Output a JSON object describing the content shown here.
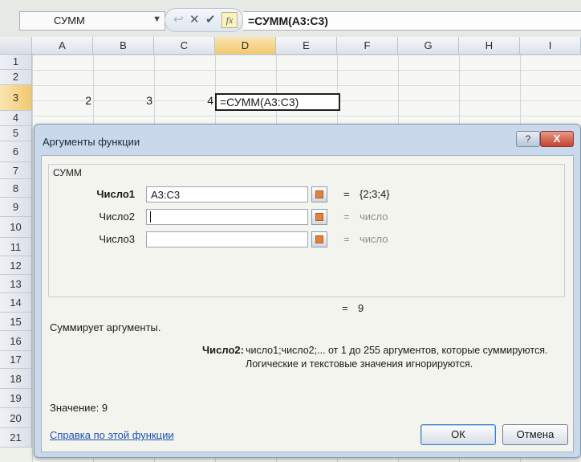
{
  "formula_bar": {
    "name_box": "СУММ",
    "formula": "=СУММ(A3:C3)",
    "fx_label": "fx"
  },
  "columns": [
    "A",
    "B",
    "C",
    "D",
    "E",
    "F",
    "G",
    "H",
    "I"
  ],
  "rows": [
    "1",
    "2",
    "3",
    "4",
    "5",
    "6",
    "7",
    "8",
    "9",
    "10",
    "11",
    "12",
    "13",
    "14",
    "15",
    "16",
    "17",
    "18",
    "19",
    "20",
    "21"
  ],
  "cells": {
    "A3": "2",
    "B3": "3",
    "C3": "4",
    "D3": "=СУММ(A3:C3)"
  },
  "dialog": {
    "title": "Аргументы функции",
    "function_name": "СУММ",
    "args": [
      {
        "label": "Число1",
        "value": "A3:C3",
        "result": "{2;3;4}"
      },
      {
        "label": "Число2",
        "value": "",
        "result": "число"
      },
      {
        "label": "Число3",
        "value": "",
        "result": "число"
      }
    ],
    "equals": "=",
    "total": "9",
    "description": "Суммирует аргументы.",
    "arg_desc_label": "Число2:",
    "arg_desc_text": "число1;число2;... от 1 до 255 аргументов, которые суммируются. Логические и текстовые значения игнорируются.",
    "value_label": "Значение:",
    "value": "9",
    "help_link": "Справка по этой функции",
    "ok_label": "ОК",
    "cancel_label": "Отмена",
    "help_btn": "?",
    "close_btn": "X"
  }
}
